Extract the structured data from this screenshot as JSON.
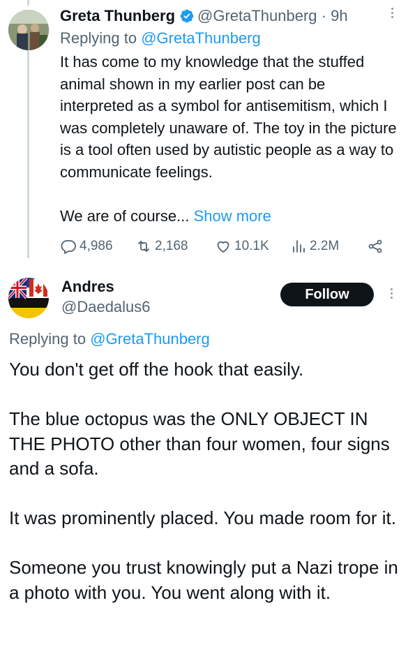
{
  "tweet1": {
    "author_name": "Greta Thunberg",
    "handle": "@GretaThunberg",
    "separator": "·",
    "time": "9h",
    "replying_prefix": "Replying to",
    "replying_mention": "@GretaThunberg",
    "body_text": "It has come to my knowledge that the stuffed animal shown in my earlier post can be interpreted as a symbol for antisemitism, which I was completely unaware of. The toy in the picture is a tool often used by autistic people as a way to communicate feelings.",
    "body_truncated": "We are of course...",
    "show_more": "Show more",
    "stats": {
      "replies": "4,986",
      "reposts": "2,168",
      "likes": "10.1K",
      "views": "2.2M"
    },
    "icons": [
      "verified-badge-icon",
      "more-icon",
      "reply-icon",
      "repost-icon",
      "like-icon",
      "views-icon",
      "share-icon"
    ]
  },
  "tweet2": {
    "author_name": "Andres",
    "handle": "@Daedalus6",
    "follow_label": "Follow",
    "replying_prefix": "Replying to",
    "replying_mention": "@GretaThunberg",
    "paragraphs": [
      "You don't get off the hook that easily.",
      "The blue octopus was the ONLY OBJECT IN THE PHOTO other than four women, four signs and a sofa.",
      "It was prominently placed. You made room for it.",
      "Someone you trust knowingly put a Nazi trope in a photo with you. You went along with it."
    ]
  },
  "colors": {
    "text": "#0f1419",
    "secondary": "#536471",
    "link": "#1d9bf0",
    "verified": "#1d9bf0",
    "follow_bg": "#0f1419",
    "thread_line": "#cfd9de"
  }
}
